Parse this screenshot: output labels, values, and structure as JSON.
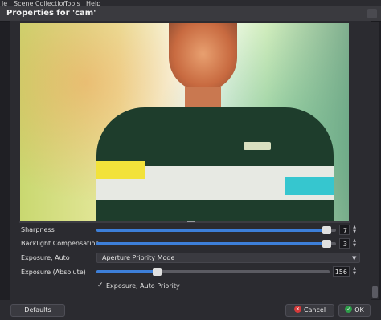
{
  "menubar": {
    "items": [
      "le",
      "Scene Collection",
      "Tools",
      "Help"
    ]
  },
  "dialog": {
    "title": "Properties for 'cam'"
  },
  "properties": {
    "sharpness": {
      "label": "Sharpness",
      "value": "7",
      "fraction": 0.98
    },
    "backlight": {
      "label": "Backlight Compensation",
      "value": "3",
      "fraction": 0.98
    },
    "exposure_auto": {
      "label": "Exposure, Auto",
      "selected": "Aperture Priority Mode"
    },
    "exposure_abs": {
      "label": "Exposure (Absolute)",
      "value": "156",
      "fraction": 0.25
    },
    "auto_priority": {
      "label": "Exposure, Auto Priority",
      "checkmark": "✓"
    }
  },
  "buttons": {
    "defaults": "Defaults",
    "cancel": "Cancel",
    "ok": "OK"
  },
  "colors": {
    "accent": "#3d7fd9",
    "cancel_icon": "#d63a3a",
    "ok_icon": "#2e9e4a"
  }
}
